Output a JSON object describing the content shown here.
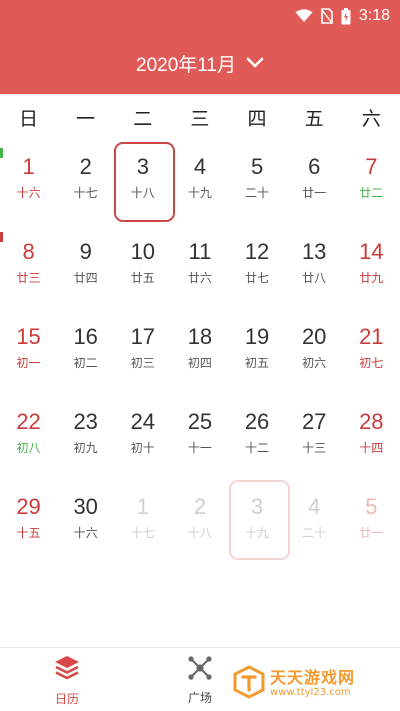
{
  "status_bar": {
    "time": "3:18",
    "icons": [
      "wifi-icon",
      "no-sim-icon",
      "battery-icon"
    ]
  },
  "header": {
    "title": "2020年11月",
    "icon": "chevron-down-icon"
  },
  "weekdays": [
    "日",
    "一",
    "二",
    "三",
    "四",
    "五",
    "六"
  ],
  "weeks": [
    [
      {
        "num": "1",
        "lunar": "十六",
        "weekend": true
      },
      {
        "num": "2",
        "lunar": "十七"
      },
      {
        "num": "3",
        "lunar": "十八",
        "today": true
      },
      {
        "num": "4",
        "lunar": "十九"
      },
      {
        "num": "5",
        "lunar": "二十"
      },
      {
        "num": "6",
        "lunar": "廿一"
      },
      {
        "num": "7",
        "lunar": "廿二",
        "weekend": true,
        "green": true
      }
    ],
    [
      {
        "num": "8",
        "lunar": "廿三",
        "weekend": true
      },
      {
        "num": "9",
        "lunar": "廿四"
      },
      {
        "num": "10",
        "lunar": "廿五"
      },
      {
        "num": "11",
        "lunar": "廿六"
      },
      {
        "num": "12",
        "lunar": "廿七"
      },
      {
        "num": "13",
        "lunar": "廿八"
      },
      {
        "num": "14",
        "lunar": "廿九",
        "weekend": true
      }
    ],
    [
      {
        "num": "15",
        "lunar": "初一",
        "weekend": true
      },
      {
        "num": "16",
        "lunar": "初二"
      },
      {
        "num": "17",
        "lunar": "初三"
      },
      {
        "num": "18",
        "lunar": "初四"
      },
      {
        "num": "19",
        "lunar": "初五"
      },
      {
        "num": "20",
        "lunar": "初六"
      },
      {
        "num": "21",
        "lunar": "初七",
        "weekend": true
      }
    ],
    [
      {
        "num": "22",
        "lunar": "初八",
        "weekend": true,
        "green": true
      },
      {
        "num": "23",
        "lunar": "初九"
      },
      {
        "num": "24",
        "lunar": "初十"
      },
      {
        "num": "25",
        "lunar": "十一"
      },
      {
        "num": "26",
        "lunar": "十二"
      },
      {
        "num": "27",
        "lunar": "十三"
      },
      {
        "num": "28",
        "lunar": "十四",
        "weekend": true
      }
    ],
    [
      {
        "num": "29",
        "lunar": "十五",
        "weekend": true
      },
      {
        "num": "30",
        "lunar": "十六"
      },
      {
        "num": "1",
        "lunar": "十七",
        "fade": true
      },
      {
        "num": "2",
        "lunar": "十八",
        "fade": true
      },
      {
        "num": "3",
        "lunar": "十九",
        "fade": true,
        "selected": true
      },
      {
        "num": "4",
        "lunar": "二十",
        "fade": true
      },
      {
        "num": "5",
        "lunar": "廿一",
        "fade": true,
        "weekend": true
      }
    ]
  ],
  "tabs": [
    {
      "label": "日历",
      "icon": "layers-icon",
      "active": true
    },
    {
      "label": "广场",
      "icon": "network-icon",
      "active": false
    }
  ],
  "watermark": {
    "text": "天天游戏网",
    "url": "www.ttyl23.com"
  },
  "colors": {
    "accent": "#e05b57",
    "weekend": "#cc3b3b",
    "green": "#45b649",
    "today_border": "#c94747"
  }
}
